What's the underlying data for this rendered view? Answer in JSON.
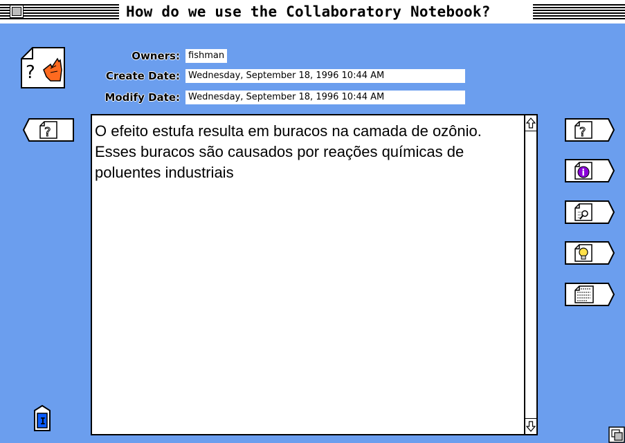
{
  "window": {
    "title": "How do we use the Collaboratory Notebook?"
  },
  "info": {
    "owners_label": "Owners:",
    "owners_value": "fishman",
    "create_label": "Create Date:",
    "create_value": "Wednesday, September 18, 1996 10:44 AM",
    "modify_label": "Modify Date:",
    "modify_value": "Wednesday, September 18, 1996 10:44 AM"
  },
  "body_text": "O efeito estufa resulta em buracos na camada de ozônio. Esses buracos são causados por reações químicas de poluentes industriais",
  "doc_icon_glyph": "?",
  "left_nav": {
    "glyph": "?"
  },
  "right_buttons": [
    {
      "icon": "question-page-icon",
      "glyph": "?"
    },
    {
      "icon": "info-page-icon",
      "glyph": "i"
    },
    {
      "icon": "magnifier-page-icon"
    },
    {
      "icon": "lightbulb-page-icon"
    },
    {
      "icon": "text-page-icon"
    }
  ],
  "bottom_icon": {
    "glyph": "I"
  },
  "colors": {
    "background": "#6b9eee",
    "icon_orange": "#ff6a1f",
    "icon_purple": "#8a00d8",
    "icon_blue": "#0a5cff"
  }
}
